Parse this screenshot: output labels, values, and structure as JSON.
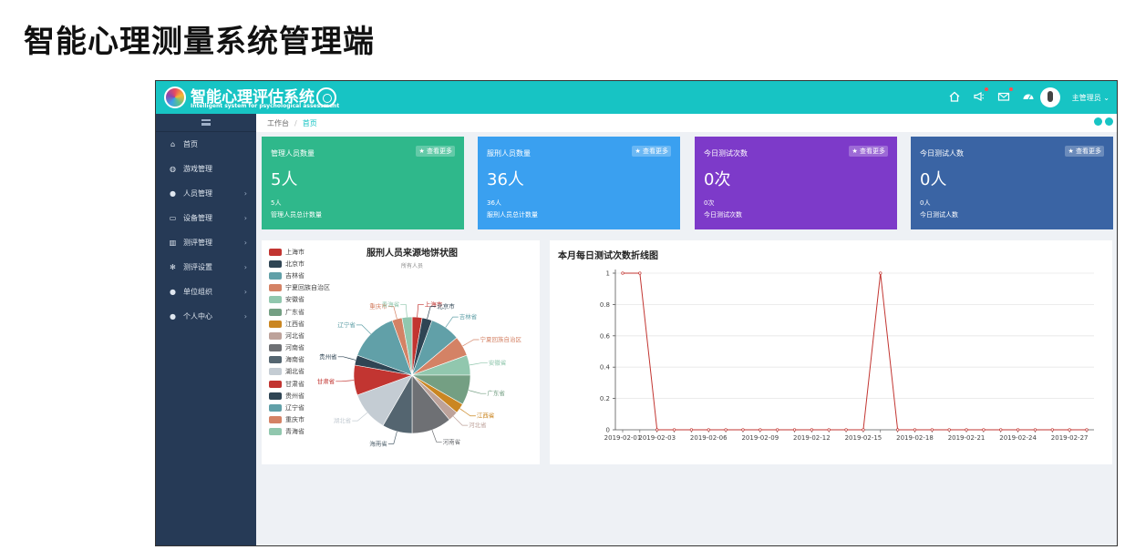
{
  "slide_title": "智能心理测量系统管理端",
  "app": {
    "title": "智能心理评估系统",
    "subtitle": "Intelligent system for psychological assessment",
    "user_name": "主管理员",
    "top_icons": [
      "home-icon",
      "megaphone-icon",
      "mail-icon",
      "dashboard-icon"
    ]
  },
  "sidebar": {
    "items": [
      {
        "label": "首页",
        "icon": "home-icon",
        "has_children": false
      },
      {
        "label": "游戏管理",
        "icon": "gamepad-icon",
        "has_children": false
      },
      {
        "label": "人员管理",
        "icon": "user-icon",
        "has_children": true
      },
      {
        "label": "设备管理",
        "icon": "monitor-icon",
        "has_children": true
      },
      {
        "label": "测评管理",
        "icon": "bar-chart-icon",
        "has_children": true
      },
      {
        "label": "测评设置",
        "icon": "gears-icon",
        "has_children": true
      },
      {
        "label": "单位组织",
        "icon": "group-icon",
        "has_children": true
      },
      {
        "label": "个人中心",
        "icon": "user-icon",
        "has_children": true
      }
    ]
  },
  "breadcrumb": {
    "root": "工作台",
    "separator": "/",
    "current": "首页"
  },
  "cards": [
    {
      "title": "管理人员数量",
      "more": "★ 查看更多",
      "value": "5人",
      "line1": "5人",
      "line2": "管理人员总计数量",
      "color": "#2fb88b"
    },
    {
      "title": "服刑人员数量",
      "more": "★ 查看更多",
      "value": "36人",
      "line1": "36人",
      "line2": "服刑人员总计数量",
      "color": "#3aa0f0"
    },
    {
      "title": "今日测试次数",
      "more": "★ 查看更多",
      "value": "0次",
      "line1": "0次",
      "line2": "今日测试次数",
      "color": "#7d3ac9"
    },
    {
      "title": "今日测试人数",
      "more": "★ 查看更多",
      "value": "0人",
      "line1": "0人",
      "line2": "今日测试人数",
      "color": "#3a64a4"
    }
  ],
  "chart_data": [
    {
      "type": "pie",
      "title": "服刑人员来源地饼状图",
      "subtitle": "所有人员",
      "legend_position": "left",
      "slices": [
        {
          "name": "上海市",
          "value": 1,
          "color": "#c23531"
        },
        {
          "name": "北京市",
          "value": 1,
          "color": "#2f4554"
        },
        {
          "name": "吉林省",
          "value": 3,
          "color": "#61a0a8"
        },
        {
          "name": "宁夏回族自治区",
          "value": 2,
          "color": "#d48265"
        },
        {
          "name": "安徽省",
          "value": 2,
          "color": "#91c7ae"
        },
        {
          "name": "广东省",
          "value": 3,
          "color": "#749f83"
        },
        {
          "name": "江西省",
          "value": 1,
          "color": "#ca8622"
        },
        {
          "name": "河北省",
          "value": 1,
          "color": "#bda29a"
        },
        {
          "name": "河南省",
          "value": 4,
          "color": "#6e7074"
        },
        {
          "name": "海南省",
          "value": 3,
          "color": "#546570"
        },
        {
          "name": "湖北省",
          "value": 4,
          "color": "#c4ccd3"
        },
        {
          "name": "甘肃省",
          "value": 3,
          "color": "#c23531"
        },
        {
          "name": "贵州省",
          "value": 1,
          "color": "#2f4554"
        },
        {
          "name": "辽宁省",
          "value": 5,
          "color": "#61a0a8"
        },
        {
          "name": "重庆市",
          "value": 1,
          "color": "#d48265"
        },
        {
          "name": "青海省",
          "value": 1,
          "color": "#91c7ae"
        }
      ]
    },
    {
      "type": "line",
      "title": "本月每日测试次数折线图",
      "x": [
        "2019-02-01",
        "2019-02-02",
        "2019-02-03",
        "2019-02-04",
        "2019-02-05",
        "2019-02-06",
        "2019-02-07",
        "2019-02-08",
        "2019-02-09",
        "2019-02-10",
        "2019-02-11",
        "2019-02-12",
        "2019-02-13",
        "2019-02-14",
        "2019-02-15",
        "2019-02-16",
        "2019-02-17",
        "2019-02-18",
        "2019-02-19",
        "2019-02-20",
        "2019-02-21",
        "2019-02-22",
        "2019-02-23",
        "2019-02-24",
        "2019-02-25",
        "2019-02-26",
        "2019-02-27",
        "2019-02-28"
      ],
      "x_tick_labels": [
        "2019-02-01",
        "2019-02-03",
        "2019-02-06",
        "2019-02-09",
        "2019-02-12",
        "2019-02-15",
        "2019-02-18",
        "2019-02-21",
        "2019-02-24",
        "2019-02-27"
      ],
      "series": [
        {
          "values": [
            1,
            1,
            0,
            0,
            0,
            0,
            0,
            0,
            0,
            0,
            0,
            0,
            0,
            0,
            0,
            1,
            0,
            0,
            0,
            0,
            0,
            0,
            0,
            0,
            0,
            0,
            0,
            0
          ],
          "color": "#c23531"
        }
      ],
      "ylim": [
        0,
        1
      ],
      "y_ticks": [
        "0",
        "0.2",
        "0.4",
        "0.6",
        "0.8",
        "1"
      ],
      "grid": true
    }
  ]
}
